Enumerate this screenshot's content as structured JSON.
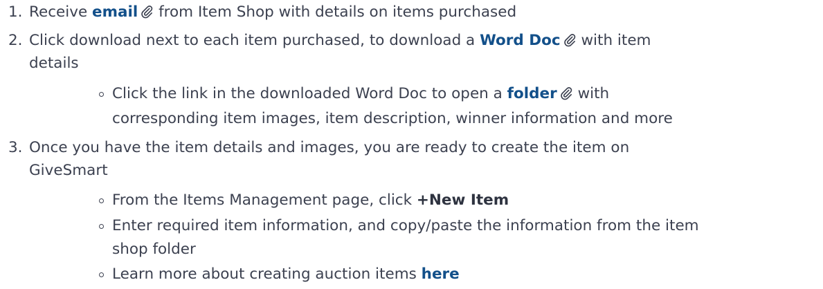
{
  "steps": [
    {
      "number": "1.",
      "parts": {
        "a": "Receive ",
        "link": "email",
        "b": " from Item Shop with details on items purchased"
      }
    },
    {
      "number": "2.",
      "parts": {
        "a": "Click download next to each item purchased, to download a ",
        "link": "Word Doc",
        "b": " with item",
        "cont": "details"
      }
    },
    {
      "number": "3.",
      "parts": {
        "a": "Once you have the item details and images, you are ready to create the item on",
        "cont": "GiveSmart"
      }
    }
  ],
  "sub2": {
    "a": "Click the link in the downloaded Word Doc to open a ",
    "link": "folder",
    "b": " with",
    "cont": "corresponding item images, item description, winner information and more"
  },
  "sub3": [
    {
      "a": "From the Items Management page, click ",
      "strong": "+New Item"
    },
    {
      "a": "Enter required item information, and copy/paste the information from the item",
      "cont": "shop folder"
    },
    {
      "a": "Learn more about creating auction items ",
      "link": "here"
    }
  ],
  "icons": {
    "attachment": "paperclip-icon"
  },
  "colors": {
    "link": "#13508a",
    "text": "#3c4150"
  }
}
